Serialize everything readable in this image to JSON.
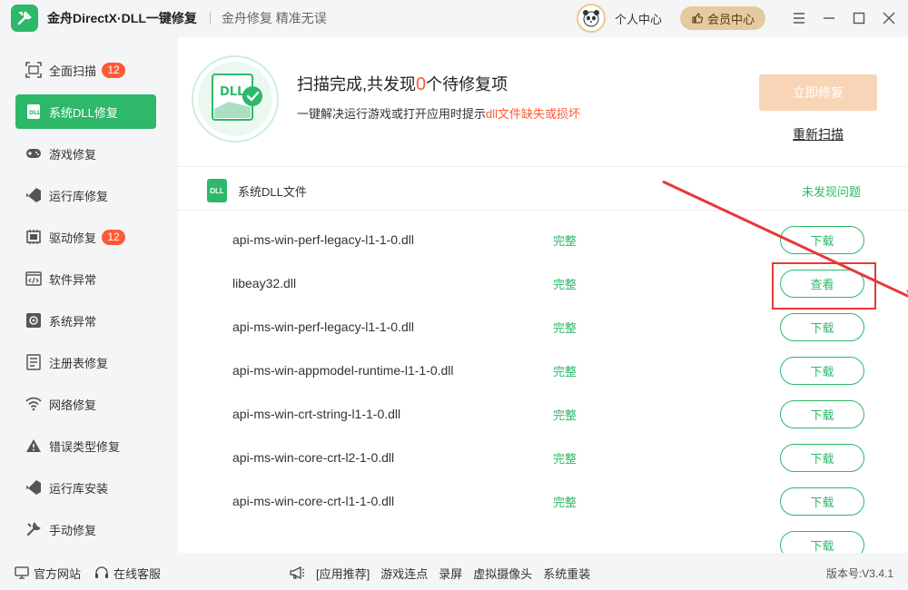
{
  "app": {
    "title": "金舟DirectX·DLL一键修复",
    "slogan": "金舟修复 精准无误"
  },
  "header": {
    "user_center": "个人中心",
    "vip_center": "会员中心"
  },
  "sidebar": {
    "items": [
      {
        "label": "全面扫描",
        "icon": "scan-icon",
        "badge": "12"
      },
      {
        "label": "系统DLL修复",
        "icon": "dll-icon",
        "active": true
      },
      {
        "label": "游戏修复",
        "icon": "gamepad-icon"
      },
      {
        "label": "运行库修复",
        "icon": "runtime-icon"
      },
      {
        "label": "驱动修复",
        "icon": "driver-icon",
        "badge": "12"
      },
      {
        "label": "软件异常",
        "icon": "code-icon"
      },
      {
        "label": "系统异常",
        "icon": "gear-icon"
      },
      {
        "label": "注册表修复",
        "icon": "registry-icon"
      },
      {
        "label": "网络修复",
        "icon": "wifi-icon"
      },
      {
        "label": "错误类型修复",
        "icon": "warning-icon"
      },
      {
        "label": "运行库安装",
        "icon": "install-icon"
      },
      {
        "label": "手动修复",
        "icon": "wrench-icon"
      }
    ]
  },
  "scan": {
    "title_pre": "扫描完成,共发现",
    "count": "0",
    "title_post": "个待修复项",
    "sub_pre": "一键解决运行游戏或打开应用时提示",
    "sub_highlight": "dll文件缺失或损坏",
    "repair_button": "立即修复",
    "rescan": "重新扫描"
  },
  "section": {
    "title": "系统DLL文件",
    "status": "未发现问题",
    "icon_text": "DLL"
  },
  "rows": [
    {
      "name": "api-ms-win-perf-legacy-l1-1-0.dll",
      "status": "完整",
      "action": "下载"
    },
    {
      "name": "libeay32.dll",
      "status": "完整",
      "action": "查看"
    },
    {
      "name": "api-ms-win-perf-legacy-l1-1-0.dll",
      "status": "完整",
      "action": "下载"
    },
    {
      "name": "api-ms-win-appmodel-runtime-l1-1-0.dll",
      "status": "完整",
      "action": "下载"
    },
    {
      "name": "api-ms-win-crt-string-l1-1-0.dll",
      "status": "完整",
      "action": "下载"
    },
    {
      "name": "api-ms-win-core-crt-l2-1-0.dll",
      "status": "完整",
      "action": "下载"
    },
    {
      "name": "api-ms-win-core-crt-l1-1-0.dll",
      "status": "完整",
      "action": "下载"
    },
    {
      "name": "",
      "status": "",
      "action": "下载"
    }
  ],
  "footer": {
    "official_site": "官方网站",
    "online_service": "在线客服",
    "recommend": "[应用推荐]",
    "links": [
      "游戏连点",
      "录屏",
      "虚拟摄像头",
      "系统重装"
    ],
    "version": "版本号:V3.4.1"
  },
  "colors": {
    "accent": "#2db86a",
    "warning": "#ff5a36",
    "annotation": "#e53935"
  }
}
